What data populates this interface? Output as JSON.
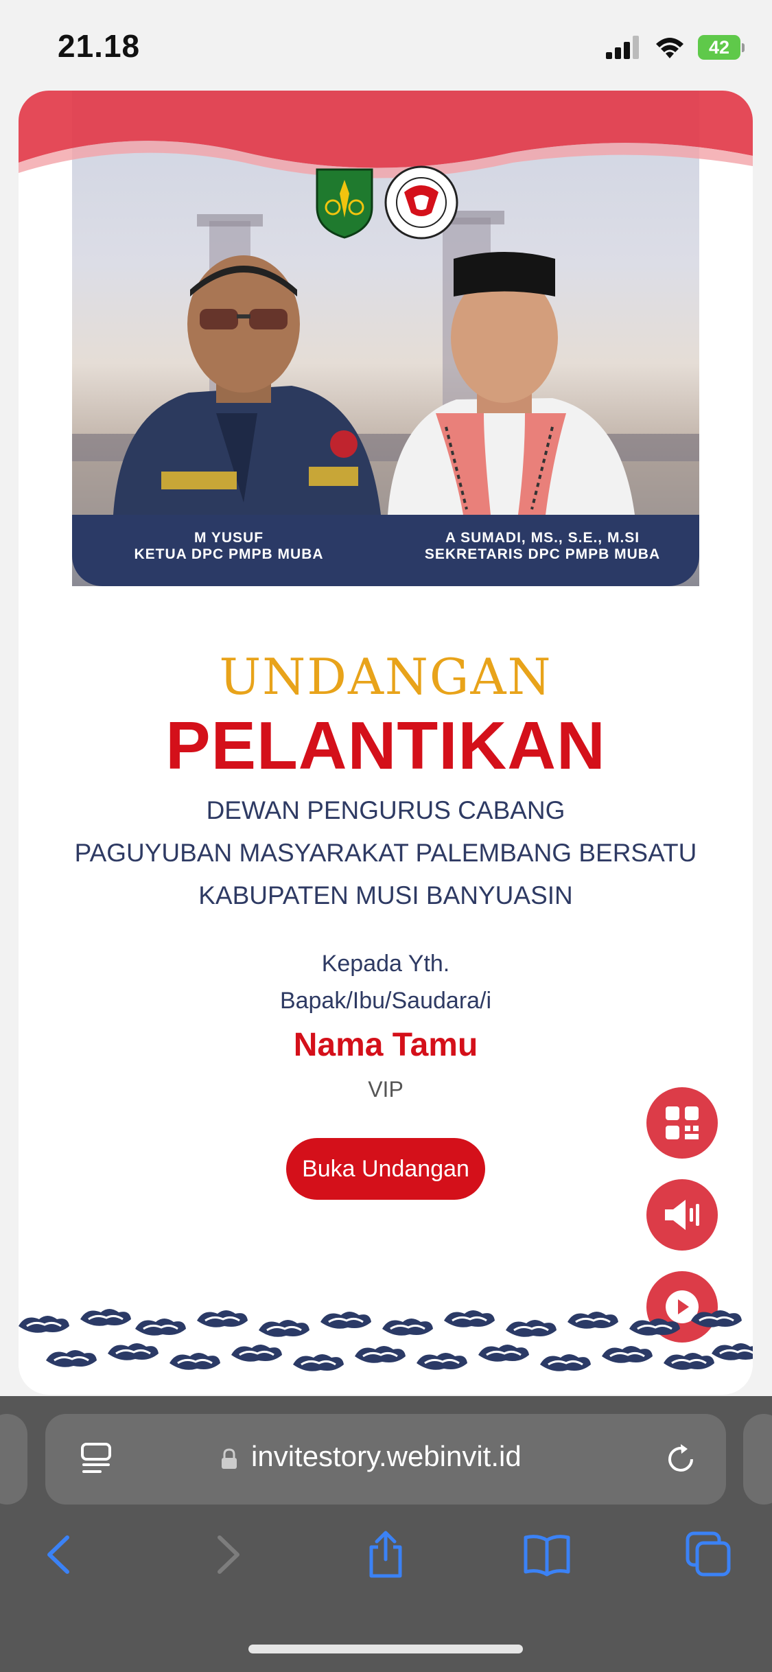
{
  "status_bar": {
    "time": "21.18",
    "battery": "42"
  },
  "card": {
    "people": [
      {
        "name": "M YUSUF",
        "role": "KETUA DPC PMPB MUBA"
      },
      {
        "name": "A SUMADI, MS., S.E., M.SI",
        "role": "SEKRETARIS DPC PMPB MUBA"
      }
    ],
    "title_top": "UNDANGAN",
    "title_main": "PELANTIKAN",
    "org_lines": [
      "DEWAN PENGURUS CABANG",
      "PAGUYUBAN MASYARAKAT PALEMBANG BERSATU",
      "KABUPATEN MUSI BANYUASIN"
    ],
    "greeting": [
      "Kepada Yth.",
      "Bapak/Ibu/Saudara/i"
    ],
    "guest_name": "Nama Tamu",
    "guest_category": "VIP",
    "open_button": "Buka Undangan",
    "accent_color": "#d4101a",
    "title_color": "#e8a31a",
    "navy_color": "#2b3a66"
  },
  "fabs": [
    "qr-code-icon",
    "speaker-icon",
    "play-icon"
  ],
  "browser": {
    "url": "invitestory.webinvit.id"
  }
}
